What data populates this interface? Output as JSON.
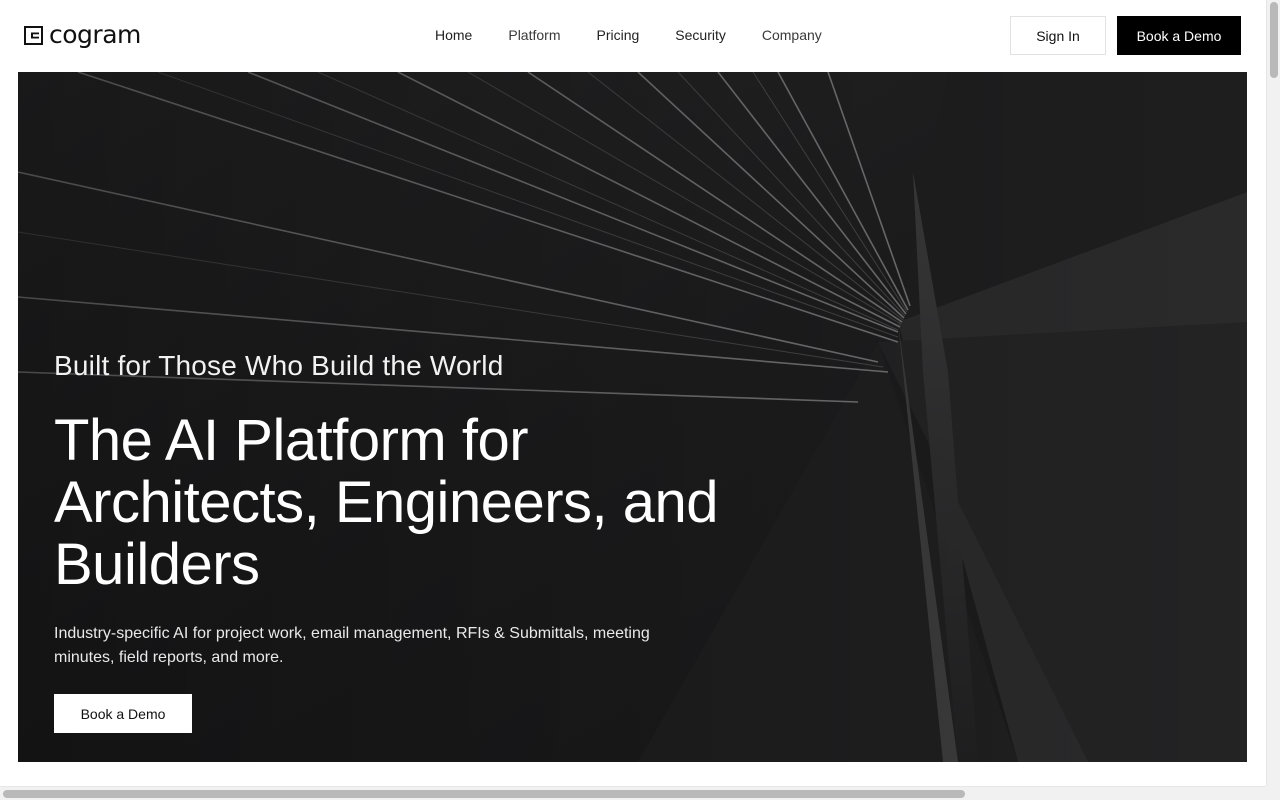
{
  "brand": {
    "name": "cogram",
    "logo_icon": "bracket-square-logo-icon"
  },
  "nav": {
    "items": [
      {
        "label": "Home"
      },
      {
        "label": "Platform"
      },
      {
        "label": "Pricing"
      },
      {
        "label": "Security"
      },
      {
        "label": "Company"
      }
    ]
  },
  "header_actions": {
    "sign_in": "Sign In",
    "book_demo": "Book a Demo"
  },
  "hero": {
    "eyebrow": "Built for Those Who Build the World",
    "headline": "The AI Platform for Architects, Engineers, and Builders",
    "subtext": "Industry-specific AI for project work, email management, RFIs & Submittals, meeting minutes, field reports, and more.",
    "cta": "Book a Demo",
    "background_image": "dark-bridge-cables-photo"
  },
  "colors": {
    "accent": "#000000",
    "hero_bg": "#1b1b1c",
    "text_on_dark": "#ffffff"
  }
}
